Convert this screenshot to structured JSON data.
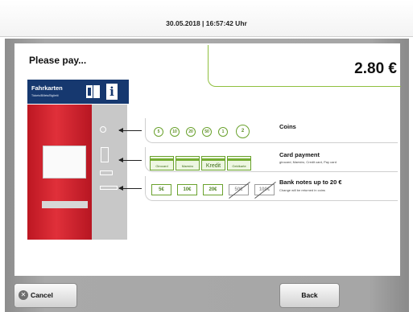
{
  "header": {
    "datetime": "30.05.2018 | 16:57:42 Uhr"
  },
  "main": {
    "prompt": "Please pay...",
    "amount": "2.80 €"
  },
  "machine": {
    "title": "Fahrkarten",
    "subtitle": "Tickets/Billets/Biglietti",
    "info_glyph": "i"
  },
  "payment": {
    "coins": {
      "title": "Coins",
      "values": [
        "5",
        "10",
        "20",
        "50",
        "1",
        "2"
      ]
    },
    "card": {
      "title": "Card payment",
      "desc": "girocard, Maestro, Credit card, Pay card",
      "cards": [
        "Girocard",
        "Maestro",
        "Kredit",
        "Geldkarte"
      ]
    },
    "notes": {
      "title": "Bank notes up to 20 €",
      "desc": "Change will be returned in coins",
      "values": [
        "5€",
        "10€",
        "20€",
        "50€",
        "100€"
      ]
    }
  },
  "buttons": {
    "cancel": "Cancel",
    "back": "Back"
  },
  "icons": [
    "close-icon",
    "coin-slot-icon",
    "keypad-icon",
    "card-slot-icon",
    "banknote-slot-icon",
    "info-icon",
    "book-icon"
  ],
  "colors": {
    "accent": "#8fbf3e",
    "machine_red": "#d32630",
    "machine_blue": "#16386f"
  }
}
